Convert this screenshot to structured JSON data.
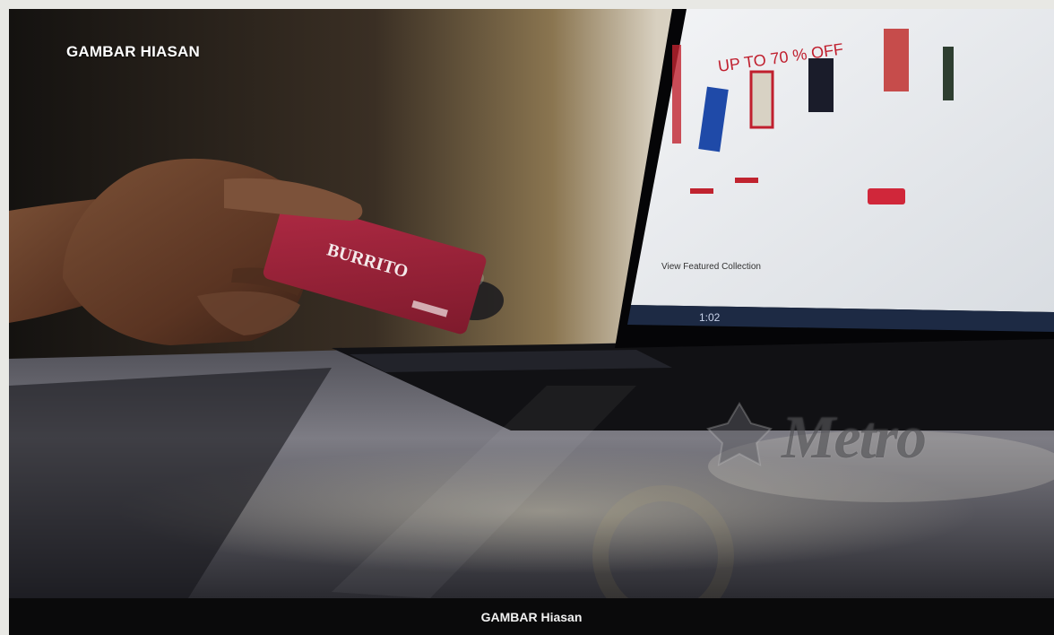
{
  "photo": {
    "overlay_label": "GAMBAR HIASAN",
    "caption": "GAMBAR Hiasan",
    "card": {
      "brand": "BURRITO"
    },
    "laptop_screen": {
      "promo": "UP TO 70 % OFF",
      "collection_label": "View Featured Collection",
      "taskbar": "1:02"
    },
    "watermark": {
      "text": "Metro"
    }
  },
  "colors": {
    "card_red": "#a3223a",
    "screen_white": "#eef0f2",
    "caption_bg": "#0a0a0b"
  }
}
